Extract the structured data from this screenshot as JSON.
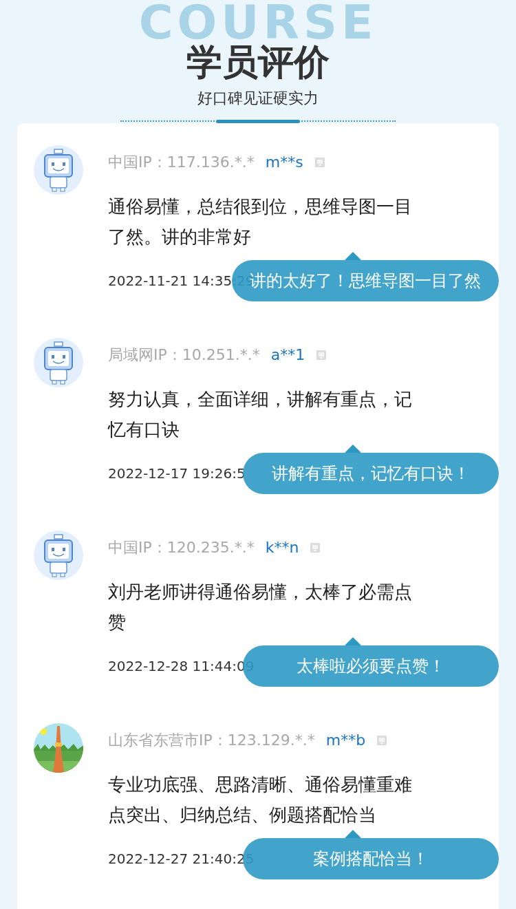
{
  "header": {
    "backdrop_text": "COURSE",
    "title": "学员评价",
    "subtitle": "好口碑见证硬实力"
  },
  "reviews": [
    {
      "avatar": {
        "kind": "robot"
      },
      "location": "中国IP：117.136.*.*",
      "user": "m**s",
      "comment": "通俗易懂，总结很到位，思维导图一目了然。讲的非常好",
      "time": "2022-11-21 14:35:29",
      "reply": "讲的太好了！思维导图一目了然"
    },
    {
      "avatar": {
        "kind": "robot"
      },
      "location": "局域网IP：10.251.*.*",
      "user": "a**1",
      "comment": "努力认真，全面详细，讲解有重点，记忆有口诀",
      "time": "2022-12-17 19:26:5",
      "reply": "讲解有重点，记忆有口诀！"
    },
    {
      "avatar": {
        "kind": "robot"
      },
      "location": "中国IP：120.235.*.*",
      "user": "k**n",
      "comment": "刘丹老师讲得通俗易懂，太棒了必需点赞",
      "time": "2022-12-28 11:44:09",
      "reply": "太棒啦必须要点赞！"
    },
    {
      "location": "山东省东营市IP：123.129.*.*",
      "user": "m**b",
      "comment": "专业功底强、思路清晰、通俗易懂重难点突出、归纳总结、例题搭配恰当",
      "time": "2022-12-27 21:40:25",
      "reply": "案例搭配恰当！"
    }
  ]
}
